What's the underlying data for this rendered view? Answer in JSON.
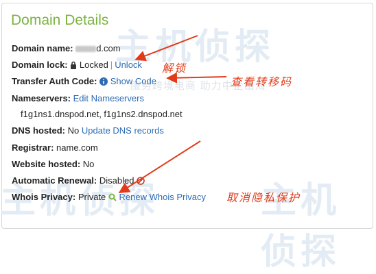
{
  "panel": {
    "title": "Domain Details"
  },
  "watermark": {
    "logo_text": "主机侦探",
    "tagline": "服务跨境电商 助力中企出海"
  },
  "details": {
    "domain_name": {
      "label": "Domain name:",
      "value": "d.com"
    },
    "domain_lock": {
      "label": "Domain lock:",
      "value": "Locked",
      "action": "Unlock"
    },
    "transfer_auth": {
      "label": "Transfer Auth Code:",
      "action": "Show Code"
    },
    "nameservers": {
      "label": "Nameservers:",
      "action": "Edit Nameservers",
      "value": "f1g1ns1.dnspod.net, f1g1ns2.dnspod.net"
    },
    "dns_hosted": {
      "label": "DNS hosted:",
      "value": "No",
      "action": "Update DNS records"
    },
    "registrar": {
      "label": "Registrar:",
      "value": "name.com"
    },
    "website_hosted": {
      "label": "Website hosted:",
      "value": "No"
    },
    "auto_renewal": {
      "label": "Automatic Renewal:",
      "value": "Disabled"
    },
    "whois_privacy": {
      "label": "Whois Privacy:",
      "value": "Private",
      "action": "Renew Whois Privacy"
    }
  },
  "annotations": {
    "unlock_note": "解锁",
    "show_code_note": "查看转移码",
    "whois_note": "取消隐私保护"
  },
  "icons": {
    "lock": "lock-icon",
    "info": "info-icon",
    "disabled": "disabled-icon",
    "privacy": "magnifier-icon"
  },
  "colors": {
    "title": "#7cb342",
    "link": "#2d6cb5",
    "annotation": "#e23b1a"
  }
}
